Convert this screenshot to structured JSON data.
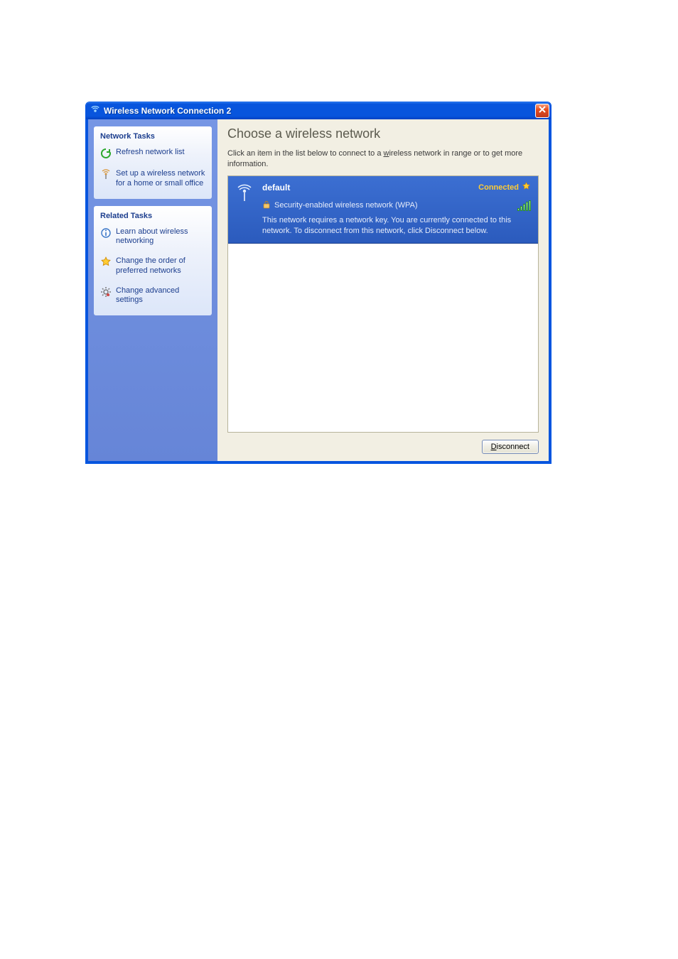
{
  "window": {
    "title": "Wireless Network Connection 2"
  },
  "sidebar": {
    "network_tasks_label": "Network Tasks",
    "related_tasks_label": "Related Tasks",
    "items": {
      "refresh": "Refresh network list",
      "setup": "Set up a wireless network for a home or small office",
      "learn": "Learn about wireless networking",
      "order": "Change the order of preferred networks",
      "advanced": "Change advanced settings"
    }
  },
  "main": {
    "heading": "Choose a wireless network",
    "subtext_pre": "Click an item in the list below to connect to a ",
    "subtext_ul_char": "w",
    "subtext_post": "ireless network in range or to get more information.",
    "network": {
      "name": "default",
      "status": "Connected",
      "security": "Security-enabled wireless network (WPA)",
      "description": "This network requires a network key. You are currently connected to this network. To disconnect from this network, click Disconnect below."
    },
    "button_ul_char": "D",
    "button_rest": "isconnect"
  }
}
